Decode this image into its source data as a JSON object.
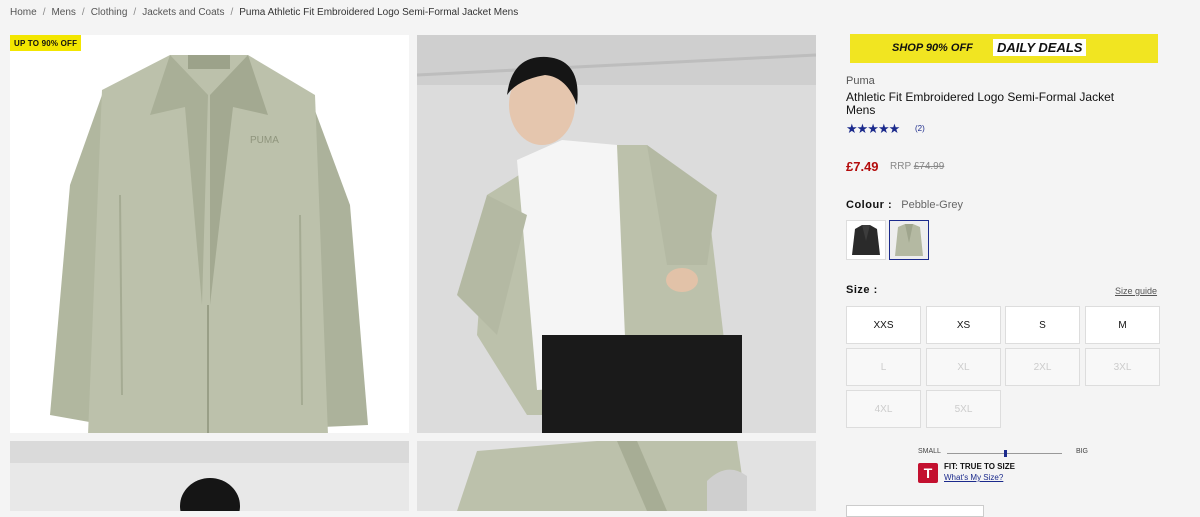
{
  "breadcrumb": {
    "items": [
      "Home",
      "Mens",
      "Clothing",
      "Jackets and Coats"
    ],
    "current": "Puma Athletic Fit Embroidered Logo Semi-Formal Jacket Mens"
  },
  "gallery": {
    "badge": "UP TO 90% OFF",
    "images": [
      "jacket-product-shot",
      "model-wearing-jacket",
      "model-back-view",
      "jacket-detail"
    ]
  },
  "promo": {
    "text_a": "SHOP 90% OFF",
    "text_b": "DAILY DEALS",
    "color": "#f1e521"
  },
  "product": {
    "brand": "Puma",
    "title": "Athletic Fit Embroidered Logo Semi-Formal Jacket Mens",
    "stars": "★★★★★",
    "rating_value": 5,
    "review_count": "(2)",
    "price": "£7.49",
    "rrp_label": "RRP",
    "rrp_value": "£74.99",
    "price_color": "#b30b0b"
  },
  "colour": {
    "label": "Colour :",
    "value": "Pebble-Grey",
    "swatches": [
      "Black",
      "Pebble-Grey"
    ],
    "selected": "Pebble-Grey"
  },
  "size": {
    "label": "Size :",
    "guide": "Size guide",
    "options": [
      "XXS",
      "XS",
      "S",
      "M",
      "L",
      "XL",
      "2XL",
      "3XL",
      "4XL",
      "5XL"
    ],
    "unavailable": [
      "L",
      "XL",
      "2XL",
      "3XL",
      "4XL",
      "5XL"
    ]
  },
  "fit": {
    "small_label": "SMALL",
    "big_label": "BIG",
    "level": 0.5,
    "badge": "T",
    "title": "FIT: TRUE TO SIZE",
    "link": "What's My Size?"
  }
}
